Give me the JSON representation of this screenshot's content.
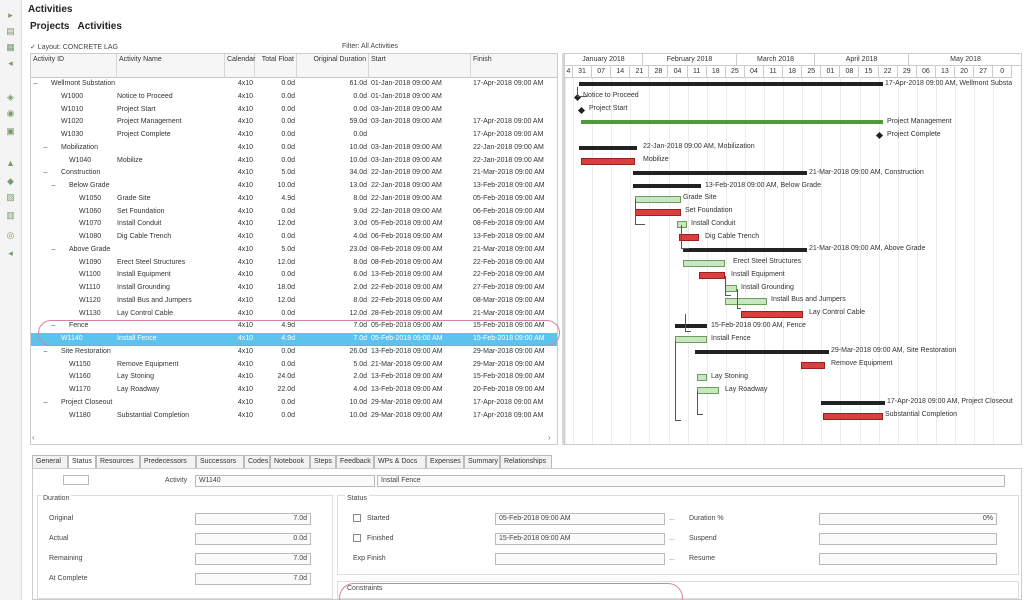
{
  "app": {
    "title": "Activities",
    "tab_projects": "Projects",
    "tab_activities": "Activities"
  },
  "layout_label": "✓ Layout: CONCRETE LAG",
  "filter_label": "Filter: All Activities",
  "columns": {
    "activity_id": "Activity ID",
    "activity_name": "Activity Name",
    "calendar": "Calendar",
    "total_float": "Total Float",
    "original_duration": "Original Duration",
    "start": "Start",
    "finish": "Finish"
  },
  "rows": [
    {
      "toggle": "−",
      "id": "Wellmont Substation",
      "name": "",
      "calendar": "4x10",
      "float": "0.0d",
      "dur": "61.0d",
      "start": "01-Jan-2018 09:00 AM",
      "finish": "17-Apr-2018 09:00 AM"
    },
    {
      "toggle": "",
      "id": "W1000",
      "name": "Notice to Proceed",
      "calendar": "4x10",
      "float": "0.0d",
      "dur": "0.0d",
      "start": "01-Jan-2018 09:00 AM",
      "finish": ""
    },
    {
      "toggle": "",
      "id": "W1010",
      "name": "Project Start",
      "calendar": "4x10",
      "float": "0.0d",
      "dur": "0.0d",
      "start": "03-Jan-2018 09:00 AM",
      "finish": ""
    },
    {
      "toggle": "",
      "id": "W1020",
      "name": "Project Management",
      "calendar": "4x10",
      "float": "0.0d",
      "dur": "59.0d",
      "start": "03-Jan-2018 09:00 AM",
      "finish": "17-Apr-2018 09:00 AM"
    },
    {
      "toggle": "",
      "id": "W1030",
      "name": "Project Complete",
      "calendar": "4x10",
      "float": "0.0d",
      "dur": "0.0d",
      "start": "",
      "finish": "17-Apr-2018 09:00 AM"
    },
    {
      "toggle": "−",
      "id": "Mobilization",
      "name": "",
      "calendar": "4x10",
      "float": "0.0d",
      "dur": "10.0d",
      "start": "03-Jan-2018 09:00 AM",
      "finish": "22-Jan-2018 09:00 AM"
    },
    {
      "toggle": "",
      "id": "W1040",
      "name": "Mobilize",
      "calendar": "4x10",
      "float": "0.0d",
      "dur": "10.0d",
      "start": "03-Jan-2018 09:00 AM",
      "finish": "22-Jan-2018 09:00 AM"
    },
    {
      "toggle": "−",
      "id": "Construction",
      "name": "",
      "calendar": "4x10",
      "float": "5.0d",
      "dur": "34.0d",
      "start": "22-Jan-2018 09:00 AM",
      "finish": "21-Mar-2018 09:00 AM"
    },
    {
      "toggle": "−",
      "id": "Below Grade",
      "name": "",
      "calendar": "4x10",
      "float": "10.0d",
      "dur": "13.0d",
      "start": "22-Jan-2018 09:00 AM",
      "finish": "13-Feb-2018 09:00 AM"
    },
    {
      "toggle": "",
      "id": "W1050",
      "name": "Grade Site",
      "calendar": "4x10",
      "float": "4.9d",
      "dur": "8.0d",
      "start": "22-Jan-2018 09:00 AM",
      "finish": "05-Feb-2018 09:00 AM"
    },
    {
      "toggle": "",
      "id": "W1060",
      "name": "Set Foundation",
      "calendar": "4x10",
      "float": "0.0d",
      "dur": "9.0d",
      "start": "22-Jan-2018 09:00 AM",
      "finish": "06-Feb-2018 09:00 AM"
    },
    {
      "toggle": "",
      "id": "W1070",
      "name": "Install Conduit",
      "calendar": "4x10",
      "float": "12.0d",
      "dur": "3.0d",
      "start": "05-Feb-2018 09:00 AM",
      "finish": "08-Feb-2018 09:00 AM"
    },
    {
      "toggle": "",
      "id": "W1080",
      "name": "Dig Cable Trench",
      "calendar": "4x10",
      "float": "0.0d",
      "dur": "4.0d",
      "start": "06-Feb-2018 09:00 AM",
      "finish": "13-Feb-2018 09:00 AM"
    },
    {
      "toggle": "−",
      "id": "Above Grade",
      "name": "",
      "calendar": "4x10",
      "float": "5.0d",
      "dur": "23.0d",
      "start": "08-Feb-2018 09:00 AM",
      "finish": "21-Mar-2018 09:00 AM"
    },
    {
      "toggle": "",
      "id": "W1090",
      "name": "Erect Steel Structures",
      "calendar": "4x10",
      "float": "12.0d",
      "dur": "8.0d",
      "start": "08-Feb-2018 09:00 AM",
      "finish": "22-Feb-2018 09:00 AM"
    },
    {
      "toggle": "",
      "id": "W1100",
      "name": "Install Equipment",
      "calendar": "4x10",
      "float": "0.0d",
      "dur": "6.0d",
      "start": "13-Feb-2018 09:00 AM",
      "finish": "22-Feb-2018 09:00 AM"
    },
    {
      "toggle": "",
      "id": "W1110",
      "name": "Install Grounding",
      "calendar": "4x10",
      "float": "18.0d",
      "dur": "2.0d",
      "start": "22-Feb-2018 09:00 AM",
      "finish": "27-Feb-2018 09:00 AM"
    },
    {
      "toggle": "",
      "id": "W1120",
      "name": "Install Bus and Jumpers",
      "calendar": "4x10",
      "float": "12.0d",
      "dur": "8.0d",
      "start": "22-Feb-2018 09:00 AM",
      "finish": "08-Mar-2018 09:00 AM"
    },
    {
      "toggle": "",
      "id": "W1130",
      "name": "Lay Control Cable",
      "calendar": "4x10",
      "float": "0.0d",
      "dur": "12.0d",
      "start": "28-Feb-2018 09:00 AM",
      "finish": "21-Mar-2018 09:00 AM"
    },
    {
      "toggle": "−",
      "id": "Fence",
      "name": "",
      "calendar": "4x10",
      "float": "4.9d",
      "dur": "7.0d",
      "start": "05-Feb-2018 09:00 AM",
      "finish": "15-Feb-2018 09:00 AM"
    },
    {
      "toggle": "",
      "id": "W1140",
      "name": "Install Fence",
      "calendar": "4x10",
      "float": "4.9d",
      "dur": "7.0d",
      "start": "05-Feb-2018 09:00 AM",
      "finish": "15-Feb-2018 09:00 AM",
      "selected": true
    },
    {
      "toggle": "−",
      "id": "Site Restoration",
      "name": "",
      "calendar": "4x10",
      "float": "0.0d",
      "dur": "26.0d",
      "start": "13-Feb-2018 09:00 AM",
      "finish": "29-Mar-2018 09:00 AM"
    },
    {
      "toggle": "",
      "id": "W1150",
      "name": "Remove Equipment",
      "calendar": "4x10",
      "float": "0.0d",
      "dur": "5.0d",
      "start": "21-Mar-2018 09:00 AM",
      "finish": "29-Mar-2018 09:00 AM"
    },
    {
      "toggle": "",
      "id": "W1160",
      "name": "Lay Stoning",
      "calendar": "4x10",
      "float": "24.0d",
      "dur": "2.0d",
      "start": "13-Feb-2018 09:00 AM",
      "finish": "15-Feb-2018 09:00 AM"
    },
    {
      "toggle": "",
      "id": "W1170",
      "name": "Lay Roadway",
      "calendar": "4x10",
      "float": "22.0d",
      "dur": "4.0d",
      "start": "13-Feb-2018 09:00 AM",
      "finish": "20-Feb-2018 09:00 AM"
    },
    {
      "toggle": "−",
      "id": "Project Closeout",
      "name": "",
      "calendar": "4x10",
      "float": "0.0d",
      "dur": "10.0d",
      "start": "29-Mar-2018 09:00 AM",
      "finish": "17-Apr-2018 09:00 AM"
    },
    {
      "toggle": "",
      "id": "W1180",
      "name": "Substantial Completion",
      "calendar": "4x10",
      "float": "0.0d",
      "dur": "10.0d",
      "start": "29-Mar-2018 09:00 AM",
      "finish": "17-Apr-2018 09:00 AM"
    }
  ],
  "gantt": {
    "months": [
      "January 2018",
      "February 2018",
      "March 2018",
      "April 2018",
      "May 2018"
    ],
    "weeks": [
      "4",
      "31",
      "07",
      "14",
      "21",
      "28",
      "04",
      "11",
      "18",
      "25",
      "04",
      "11",
      "18",
      "25",
      "01",
      "08",
      "15",
      "22",
      "29",
      "06",
      "13",
      "20",
      "27",
      "0"
    ],
    "labels": [
      "17-Apr-2018 09:00 AM, Wellmont Substa",
      "Notice to Proceed",
      "Project Start",
      "Project Management",
      "Project Complete",
      "22-Jan-2018 09:00 AM, Mobilization",
      "Mobilize",
      "21-Mar-2018 09:00 AM, Construction",
      "13-Feb-2018 09:00 AM, Below Grade",
      "Grade Site",
      "Set Foundation",
      "Install Conduit",
      "Dig Cable Trench",
      "21-Mar-2018 09:00 AM, Above Grade",
      "Erect Steel Structures",
      "Install Equipment",
      "Install Grounding",
      "Install Bus and Jumpers",
      "Lay Control Cable",
      "15-Feb-2018 09:00 AM, Fence",
      "Install Fence",
      "29-Mar-2018 09:00 AM, Site Restoration",
      "Remove Equipment",
      "Lay Stoning",
      "Lay Roadway",
      "17-Apr-2018 09:00 AM, Project Closeout",
      "Substantial Completion"
    ]
  },
  "detail": {
    "tabs": [
      "General",
      "Status",
      "Resources",
      "Predecessors",
      "Successors",
      "Codes",
      "Notebook",
      "Steps",
      "Feedback",
      "WPs & Docs",
      "Expenses",
      "Summary",
      "Relationships"
    ],
    "activity_label": "Activity",
    "activity_id": "W1140",
    "activity_name": "Install Fence",
    "duration_title": "Duration",
    "original_label": "Original",
    "original_value": "7.0d",
    "actual_label": "Actual",
    "actual_value": "0.0d",
    "remaining_label": "Remaining",
    "remaining_value": "7.0d",
    "at_complete_label": "At Complete",
    "at_complete_value": "7.0d",
    "status_title": "Status",
    "started_label": "Started",
    "started_value": "05-Feb-2018 09:00 AM",
    "finished_label": "Finished",
    "finished_value": "15-Feb-2018 09:00 AM",
    "exp_finish_label": "Exp Finish",
    "duration_pct_label": "Duration %",
    "duration_pct_value": "0%",
    "suspend_label": "Suspend",
    "resume_label": "Resume",
    "constraints_title": "Constraints",
    "dots": "..."
  },
  "colors": {
    "critical": "#d93f3f",
    "non_critical": "#c8e6c0",
    "summary": "#222222",
    "selection": "#5bc3ec"
  }
}
